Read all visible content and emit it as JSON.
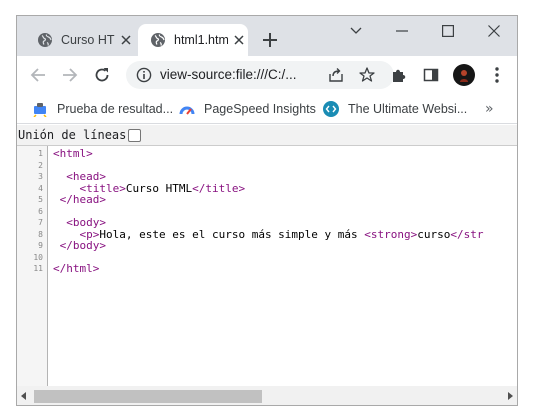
{
  "tabs": [
    {
      "title": "Curso HTML",
      "active": false
    },
    {
      "title": "html1.htm",
      "active": true
    }
  ],
  "address_bar": {
    "url": "view-source:file:///C:/..."
  },
  "bookmarks": [
    {
      "label": "Prueba de resultad...",
      "icon": "google-search-console-icon"
    },
    {
      "label": "PageSpeed Insights",
      "icon": "pagespeed-icon"
    },
    {
      "label": "The Ultimate Websi...",
      "icon": "code-circle-icon"
    }
  ],
  "wrap_lines": {
    "label": "Unión de líneas",
    "checked": false
  },
  "source_lines": [
    {
      "num": "1",
      "parts": [
        {
          "t": "tag",
          "v": "<html>"
        }
      ]
    },
    {
      "num": "2",
      "parts": []
    },
    {
      "num": "3",
      "parts": [
        {
          "t": "txt",
          "v": "  "
        },
        {
          "t": "tag",
          "v": "<head>"
        }
      ]
    },
    {
      "num": "4",
      "parts": [
        {
          "t": "txt",
          "v": "    "
        },
        {
          "t": "tag",
          "v": "<title>"
        },
        {
          "t": "txt",
          "v": "Curso HTML"
        },
        {
          "t": "tag",
          "v": "</title>"
        }
      ]
    },
    {
      "num": "5",
      "parts": [
        {
          "t": "txt",
          "v": " "
        },
        {
          "t": "tag",
          "v": "</head>"
        }
      ]
    },
    {
      "num": "6",
      "parts": []
    },
    {
      "num": "7",
      "parts": [
        {
          "t": "txt",
          "v": "  "
        },
        {
          "t": "tag",
          "v": "<body>"
        }
      ]
    },
    {
      "num": "8",
      "parts": [
        {
          "t": "txt",
          "v": "    "
        },
        {
          "t": "tag",
          "v": "<p>"
        },
        {
          "t": "txt",
          "v": "Hola, este es el curso más simple y más "
        },
        {
          "t": "tag",
          "v": "<strong>"
        },
        {
          "t": "txt",
          "v": "curso"
        },
        {
          "t": "tag",
          "v": "</str"
        }
      ]
    },
    {
      "num": "9",
      "parts": [
        {
          "t": "txt",
          "v": " "
        },
        {
          "t": "tag",
          "v": "</body>"
        }
      ]
    },
    {
      "num": "10",
      "parts": []
    },
    {
      "num": "11",
      "parts": [
        {
          "t": "tag",
          "v": "</html>"
        }
      ]
    }
  ],
  "colors": {
    "tag": "#881280",
    "text": "#000000",
    "tab_strip": "#dee1e6",
    "omnibox": "#f1f3f4"
  }
}
